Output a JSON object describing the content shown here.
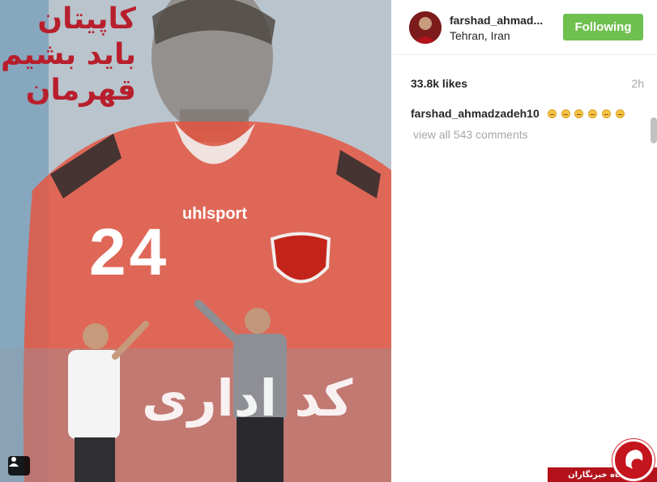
{
  "post": {
    "username": "farshad_ahmad...",
    "location": "Tehran, Iran",
    "follow_label": "Following",
    "likes": "33.8k likes",
    "time_ago": "2h",
    "caption_user": "farshad_ahmadzadeh10",
    "caption_emoji_count": 6,
    "view_comments": "view all 543 comments"
  },
  "photo": {
    "banner_text_lines": [
      "کاپیتان",
      "باید بشیم",
      "قهرمان"
    ],
    "jersey_brand": "uhlsport",
    "jersey_number": "24",
    "jersey_bottom_text": "کد اداری",
    "tag_icon": "user-tag-icon"
  },
  "watermark": {
    "label": "باشگاه خبرنگاران",
    "logo_icon": "brand-logo-icon"
  },
  "colors": {
    "follow_green": "#70c050",
    "jersey_red": "#e8533d",
    "watermark_red": "#b3121b"
  }
}
